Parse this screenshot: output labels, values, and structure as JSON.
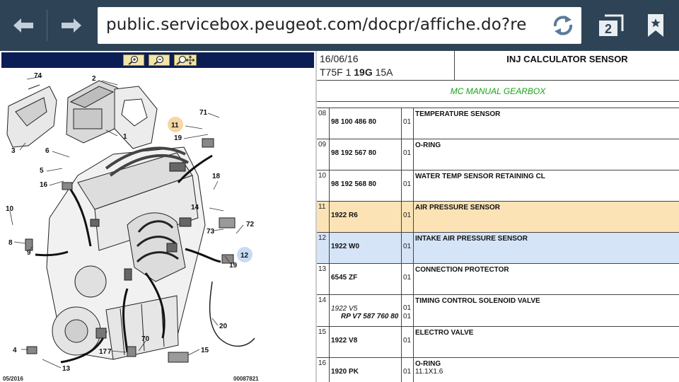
{
  "browser": {
    "url": "public.servicebox.peugeot.com/docpr/affiche.do?re",
    "tab_count": "2",
    "icons": [
      "back-arrow-icon",
      "forward-arrow-icon",
      "reload-icon",
      "tabs-icon",
      "bookmark-icon"
    ]
  },
  "diagram": {
    "footer_left": "05/2016",
    "footer_right": "00087821",
    "callouts": [
      "74",
      "2",
      "1",
      "3",
      "6",
      "5",
      "16",
      "11",
      "19",
      "71",
      "18",
      "14",
      "73",
      "72",
      "12",
      "19",
      "10",
      "8",
      "9",
      "20",
      "4",
      "17",
      "7",
      "70",
      "15",
      "13"
    ],
    "highlight_colors": {
      "yellow": "#fbe3b6",
      "blue": "#d6e4f7"
    }
  },
  "header": {
    "date": "16/06/16",
    "model_prefix": "T75F 1 ",
    "model_bold": "19G",
    "model_suffix": " 15A",
    "title": "INJ CALCULATOR SENSOR",
    "subtitle": "MC MANUAL GEARBOX"
  },
  "rows": [
    {
      "num": "08",
      "ref": "98 100 486 80",
      "qty": "01",
      "desc": "TEMPERATURE SENSOR",
      "note": "",
      "highlight": ""
    },
    {
      "num": "09",
      "ref": "98 192 567 80",
      "qty": "01",
      "desc": "O-RING",
      "note": "",
      "highlight": ""
    },
    {
      "num": "10",
      "ref": "98 192 568 80",
      "qty": "01",
      "desc": "WATER TEMP SENSOR RETAINING CL",
      "note": "",
      "highlight": ""
    },
    {
      "num": "11",
      "ref": "1922 R6",
      "qty": "01",
      "desc": "AIR PRESSURE SENSOR",
      "note": "",
      "highlight": "yellow"
    },
    {
      "num": "12",
      "ref": "1922 W0",
      "qty": "01",
      "desc": "INTAKE AIR PRESSURE SENSOR",
      "note": "",
      "highlight": "blue"
    },
    {
      "num": "13",
      "ref": "6545 ZF",
      "qty": "01",
      "desc": "CONNECTION PROTECTOR",
      "note": "",
      "highlight": ""
    },
    {
      "num": "14",
      "ref": "1922 V5",
      "ref_sub": "RP V7 587 760 80",
      "qty": "01",
      "qty2": "01",
      "desc": "TIMING CONTROL SOLENOID VALVE",
      "note": "",
      "highlight": ""
    },
    {
      "num": "15",
      "ref": "1922 V8",
      "qty": "01",
      "desc": "ELECTRO VALVE",
      "note": "",
      "highlight": ""
    },
    {
      "num": "16",
      "ref": "1920 PK",
      "qty": "01",
      "desc": "O-RING",
      "note": "11.1X1.6",
      "highlight": ""
    }
  ]
}
